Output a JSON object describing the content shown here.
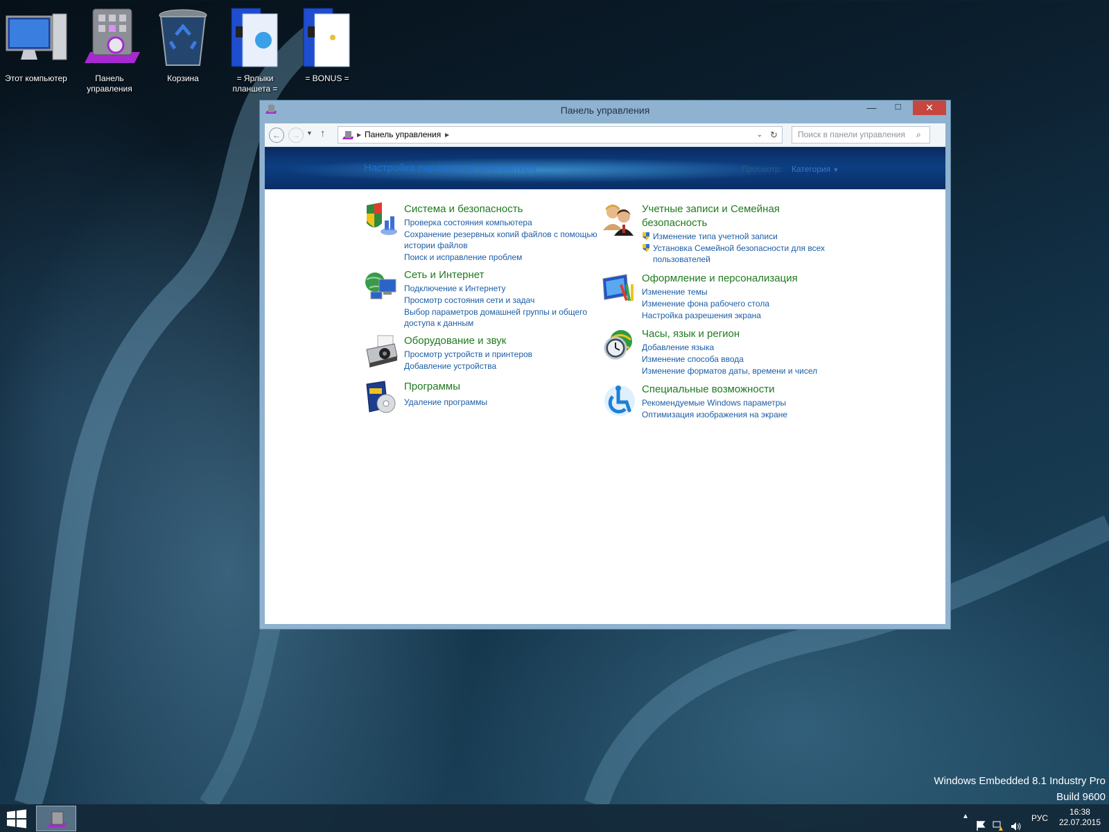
{
  "desktop": {
    "icons": [
      {
        "label": "Этот компьютер"
      },
      {
        "label": "Панель управления"
      },
      {
        "label": "Корзина"
      },
      {
        "label": "= Ярлыки планшета ="
      },
      {
        "label": "= BONUS ="
      }
    ]
  },
  "window": {
    "title": "Панель управления",
    "min": "—",
    "max": "☐",
    "close": "✕"
  },
  "navbar": {
    "back": "←",
    "forward": "→",
    "up": "↑",
    "breadcrumb": "Панель управления",
    "search_placeholder": "Поиск в панели управления"
  },
  "banner": {
    "heading": "Настройка параметров компьютера",
    "view_label": "Просмотр:",
    "view_value": "Категория"
  },
  "categories": [
    {
      "title": "Система и безопасность",
      "icon": "shield-chart-icon",
      "links": [
        "Проверка состояния компьютера",
        "Сохранение резервных копий файлов с помощью истории файлов",
        "Поиск и исправление проблем"
      ]
    },
    {
      "title": "Сеть и Интернет",
      "icon": "network-globe-icon",
      "links": [
        "Подключение к Интернету",
        "Просмотр состояния сети и задач",
        "Выбор параметров домашней группы и общего доступа к данным"
      ]
    },
    {
      "title": "Оборудование и звук",
      "icon": "printer-icon",
      "links": [
        "Просмотр устройств и принтеров",
        "Добавление устройства"
      ]
    },
    {
      "title": "Программы",
      "icon": "programs-disc-icon",
      "links": [
        "Удаление программы"
      ]
    },
    {
      "title": "Учетные записи и Семейная безопасность",
      "icon": "users-icon",
      "links": [
        "Изменение типа учетной записи",
        "Установка Семейной безопасности для всех пользователей"
      ]
    },
    {
      "title": "Оформление и персонализация",
      "icon": "monitor-palette-icon",
      "links": [
        "Изменение темы",
        "Изменение фона рабочего стола",
        "Настройка разрешения экрана"
      ]
    },
    {
      "title": "Часы, язык и регион",
      "icon": "clock-globe-icon",
      "links": [
        "Добавление языка",
        "Изменение способа ввода",
        "Изменение форматов даты, времени и чисел"
      ]
    },
    {
      "title": "Специальные возможности",
      "icon": "accessibility-icon",
      "links": [
        "Рекомендуемые Windows параметры",
        "Оптимизация изображения на экране"
      ]
    }
  ],
  "watermark": {
    "line1": "Windows Embedded 8.1 Industry Pro",
    "line2": "Build 9600"
  },
  "taskbar": {
    "lang": "РУС",
    "time": "16:38",
    "date": "22.07.2015"
  },
  "colors": {
    "link": "#1b5da6",
    "category_title": "#1f7a1f",
    "window_frame": "#8eb2cf",
    "close_button": "#c7463f"
  }
}
